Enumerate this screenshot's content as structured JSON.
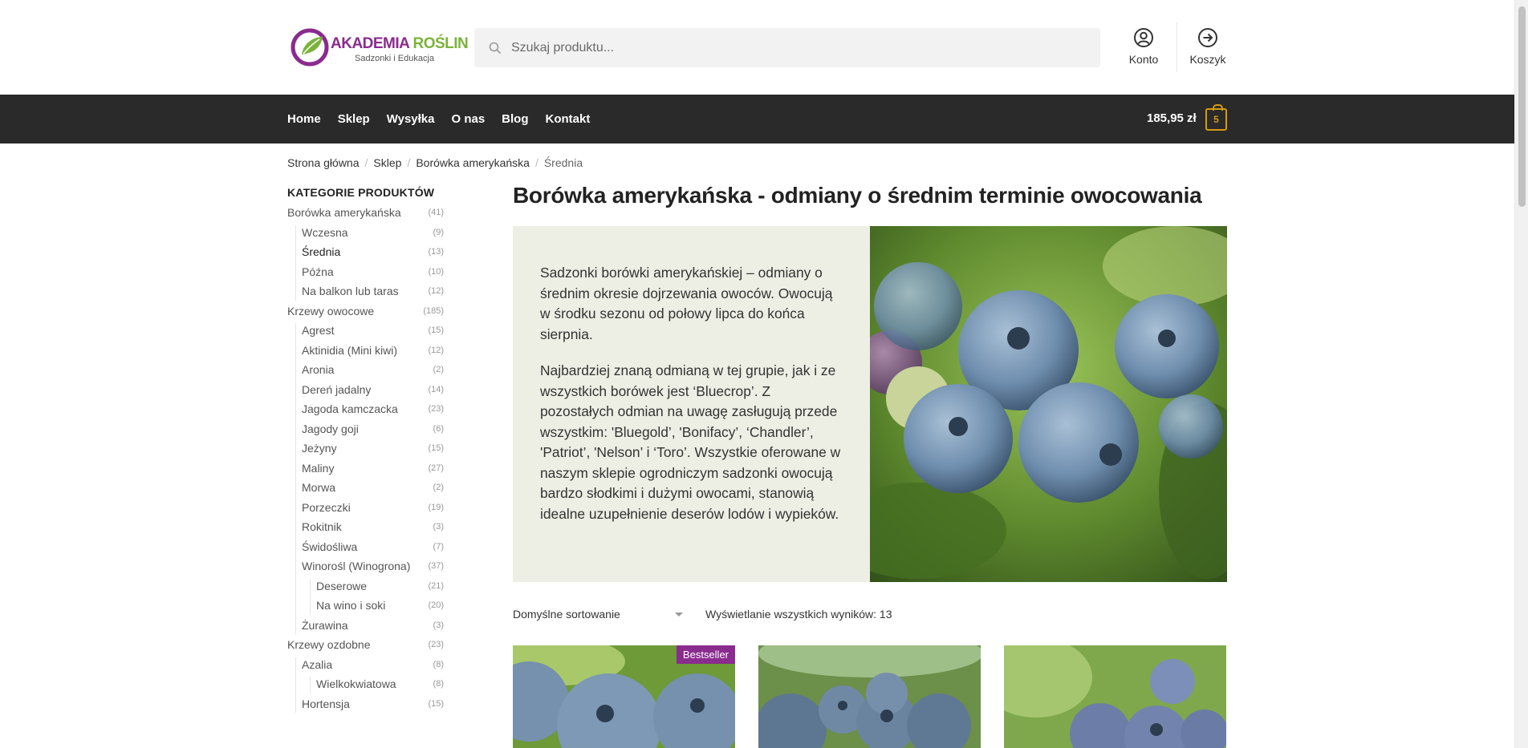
{
  "header": {
    "logo": {
      "brand_part1": "AKADEMIA ",
      "brand_part2": "ROŚLIN",
      "subtitle": "Sadzonki i Edukacja"
    },
    "search": {
      "placeholder": "Szukaj produktu..."
    },
    "account_label": "Konto",
    "cart_label": "Koszyk"
  },
  "nav": {
    "items": [
      "Home",
      "Sklep",
      "Wysyłka",
      "O nas",
      "Blog",
      "Kontakt"
    ],
    "cart_total": "185,95 zł",
    "cart_count": "5"
  },
  "breadcrumb": [
    "Strona główna",
    "Sklep",
    "Borówka amerykańska",
    "Średnia"
  ],
  "sidebar": {
    "title": "KATEGORIE PRODUKTÓW",
    "categories": [
      {
        "label": "Borówka amerykańska",
        "count": "(41)",
        "level": 0
      },
      {
        "label": "Wczesna",
        "count": "(9)",
        "level": 1
      },
      {
        "label": "Średnia",
        "count": "(13)",
        "level": 1,
        "active": true
      },
      {
        "label": "Późna",
        "count": "(10)",
        "level": 1
      },
      {
        "label": "Na balkon lub taras",
        "count": "(12)",
        "level": 1
      },
      {
        "label": "Krzewy owocowe",
        "count": "(185)",
        "level": 0
      },
      {
        "label": "Agrest",
        "count": "(15)",
        "level": 1
      },
      {
        "label": "Aktinidia (Mini kiwi)",
        "count": "(12)",
        "level": 1
      },
      {
        "label": "Aronia",
        "count": "(2)",
        "level": 1
      },
      {
        "label": "Dereń jadalny",
        "count": "(14)",
        "level": 1
      },
      {
        "label": "Jagoda kamczacka",
        "count": "(23)",
        "level": 1
      },
      {
        "label": "Jagody goji",
        "count": "(6)",
        "level": 1
      },
      {
        "label": "Jeżyny",
        "count": "(15)",
        "level": 1
      },
      {
        "label": "Maliny",
        "count": "(27)",
        "level": 1
      },
      {
        "label": "Morwa",
        "count": "(2)",
        "level": 1
      },
      {
        "label": "Porzeczki",
        "count": "(19)",
        "level": 1
      },
      {
        "label": "Rokitnik",
        "count": "(3)",
        "level": 1
      },
      {
        "label": "Świdośliwa",
        "count": "(7)",
        "level": 1
      },
      {
        "label": "Winorośl (Winogrona)",
        "count": "(37)",
        "level": 1
      },
      {
        "label": "Deserowe",
        "count": "(21)",
        "level": 2
      },
      {
        "label": "Na wino i soki",
        "count": "(20)",
        "level": 2
      },
      {
        "label": "Żurawina",
        "count": "(3)",
        "level": 1
      },
      {
        "label": "Krzewy ozdobne",
        "count": "(23)",
        "level": 0
      },
      {
        "label": "Azalia",
        "count": "(8)",
        "level": 1
      },
      {
        "label": "Wielkokwiatowa",
        "count": "(8)",
        "level": 2
      },
      {
        "label": "Hortensja",
        "count": "(15)",
        "level": 1
      }
    ]
  },
  "main": {
    "title": "Borówka amerykańska - odmiany o średnim terminie owocowania",
    "description_p1": "Sadzonki borówki amerykańskiej – odmiany o średnim okresie dojrzewania owoców. Owocują w środku sezonu od połowy lipca do końca sierpnia.",
    "description_p2": "Najbardziej znaną odmianą w tej grupie, jak i ze wszystkich borówek jest ‘Bluecrop’. Z pozostałych odmian na uwagę zasługują przede wszystkim: 'Bluegold’, 'Bonifacy’, ‘Chandler’, 'Patriot’, 'Nelson’ i ‘Toro’. Wszystkie oferowane w naszym sklepie ogrodniczym sadzonki owocują bardzo słodkimi i dużymi owocami, stanowią idealne uzupełnienie deserów lodów i wypieków.",
    "sort_selected": "Domyślne sortowanie",
    "result_count": "Wyświetlanie wszystkich wyników: 13",
    "products": [
      {
        "badge": "Bestseller"
      },
      {
        "badge": ""
      },
      {
        "badge": ""
      }
    ]
  },
  "colors": {
    "brand_purple": "#8a2b8e",
    "brand_green": "#7bb33a",
    "nav_bg": "#2a2a2a",
    "cart_accent": "#d59a10",
    "hero_bg": "#edeee4"
  }
}
